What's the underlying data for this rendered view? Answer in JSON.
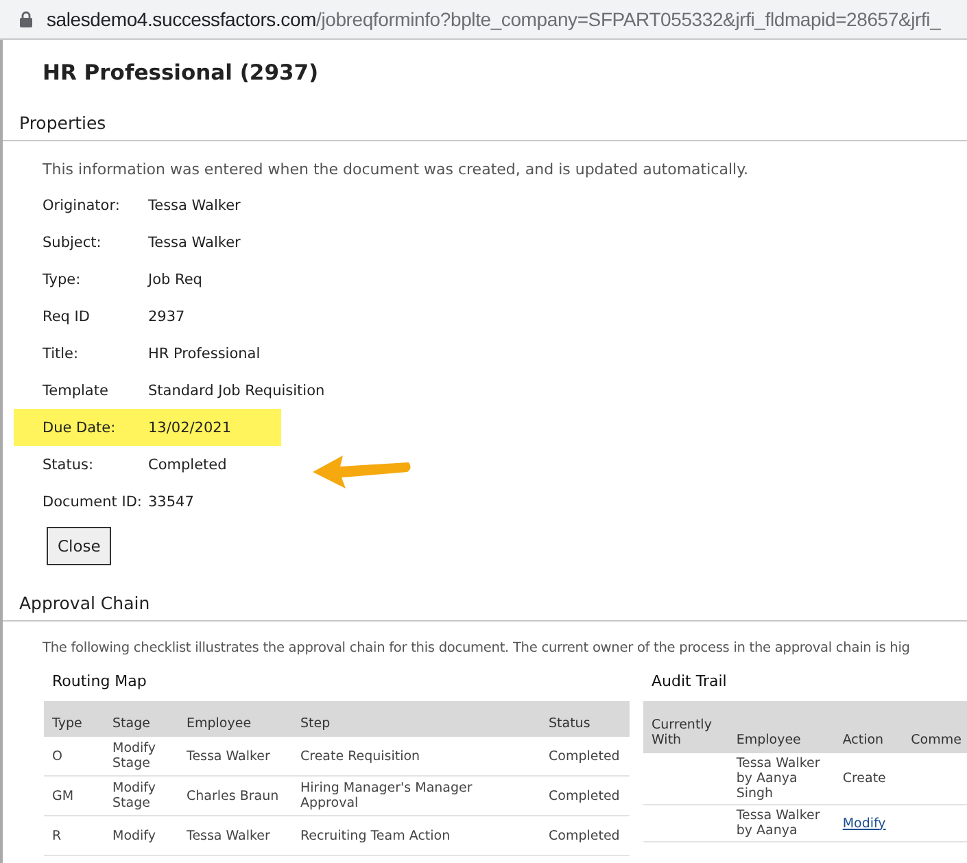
{
  "address_bar": {
    "domain": "salesdemo4.successfactors.com",
    "path": "/jobreqforminfo?bplte_company=SFPART055332&jrfi_fldmapid=28657&jrfi_"
  },
  "title": "HR Professional (2937)",
  "properties": {
    "heading": "Properties",
    "intro": "This information was entered when the document was created, and is updated automatically.",
    "fields": [
      {
        "label": "Originator:",
        "value": "Tessa Walker",
        "highlighted": false
      },
      {
        "label": "Subject:",
        "value": "Tessa Walker",
        "highlighted": false
      },
      {
        "label": "Type:",
        "value": "Job Req",
        "highlighted": false
      },
      {
        "label": "Req ID",
        "value": "2937",
        "highlighted": false
      },
      {
        "label": "Title:",
        "value": "HR Professional",
        "highlighted": false
      },
      {
        "label": "Template",
        "value": "Standard Job Requisition",
        "highlighted": false
      },
      {
        "label": "Due Date:",
        "value": "13/02/2021",
        "highlighted": true
      },
      {
        "label": "Status:",
        "value": "Completed",
        "highlighted": false
      },
      {
        "label": "Document ID:",
        "value": "33547",
        "highlighted": false
      }
    ]
  },
  "close_button": "Close",
  "approval_chain": {
    "heading": "Approval Chain",
    "intro": "The following checklist illustrates the approval chain for this document. The current owner of the process in the approval chain is hig",
    "routing_map": {
      "title": "Routing Map",
      "columns": [
        "Type",
        "Stage",
        "Employee",
        "Step",
        "Status"
      ],
      "rows": [
        [
          "O",
          "Modify Stage",
          "Tessa Walker",
          "Create Requisition",
          "Completed"
        ],
        [
          "GM",
          "Modify Stage",
          "Charles Braun",
          "Hiring Manager's Manager Approval",
          "Completed"
        ],
        [
          "R",
          "Modify",
          "Tessa Walker",
          "Recruiting Team Action",
          "Completed"
        ]
      ]
    },
    "audit_trail": {
      "title": "Audit Trail",
      "columns": [
        "Currently With",
        "Employee",
        "Action",
        "Comme"
      ],
      "rows": [
        {
          "employee": "Tessa Walker by Aanya Singh",
          "action": "Create",
          "action_link": false
        },
        {
          "employee": "Tessa Walker by Aanya",
          "action": "Modify",
          "action_link": true
        }
      ]
    }
  }
}
